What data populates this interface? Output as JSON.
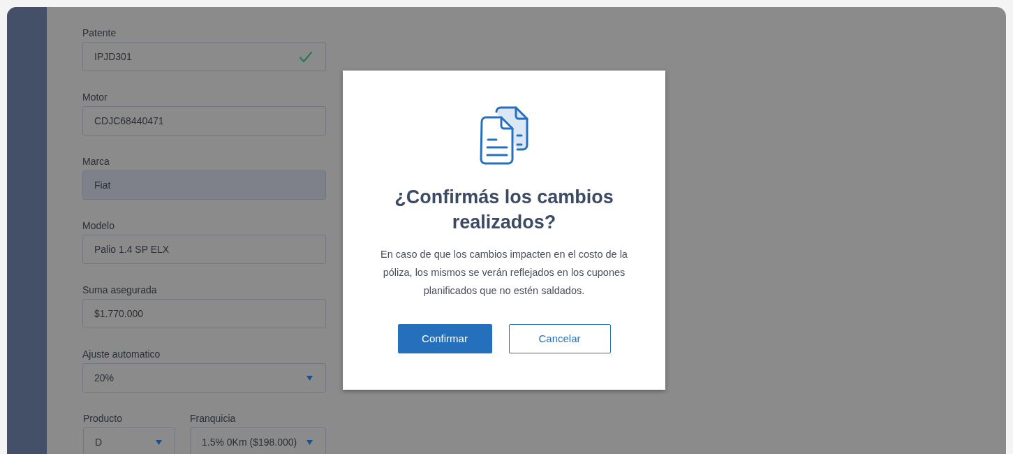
{
  "form": {
    "fields": [
      {
        "label": "Patente",
        "value": "IPJD301",
        "kind": "text",
        "valid": true
      },
      {
        "label": "Motor",
        "value": "CDJC68440471",
        "kind": "text",
        "valid": false
      },
      {
        "label": "Marca",
        "value": "Fiat",
        "kind": "disabled",
        "valid": false
      },
      {
        "label": "Modelo",
        "value": "Palio 1.4 SP ELX",
        "kind": "text",
        "valid": false
      },
      {
        "label": "Suma asegurada",
        "value": "$1.770.000",
        "kind": "text",
        "valid": false
      },
      {
        "label": "Ajuste automatico",
        "value": "20%",
        "kind": "select",
        "valid": false
      }
    ],
    "pair": [
      {
        "label": "Producto",
        "value": "D",
        "kind": "select"
      },
      {
        "label": "Franquicia",
        "value": "1.5% 0Km ($198.000)",
        "kind": "select"
      }
    ]
  },
  "dialog": {
    "title": "¿Confirmás los cambios realizados?",
    "message": "En caso de que los cambios impacten en el costo de la póliza, los mismos se verán reflejados en los cupones planificados que no estén saldados.",
    "buttons": [
      {
        "label": "Confirmar",
        "kind": "primary"
      },
      {
        "label": "Cancelar",
        "kind": "secondary"
      }
    ]
  }
}
